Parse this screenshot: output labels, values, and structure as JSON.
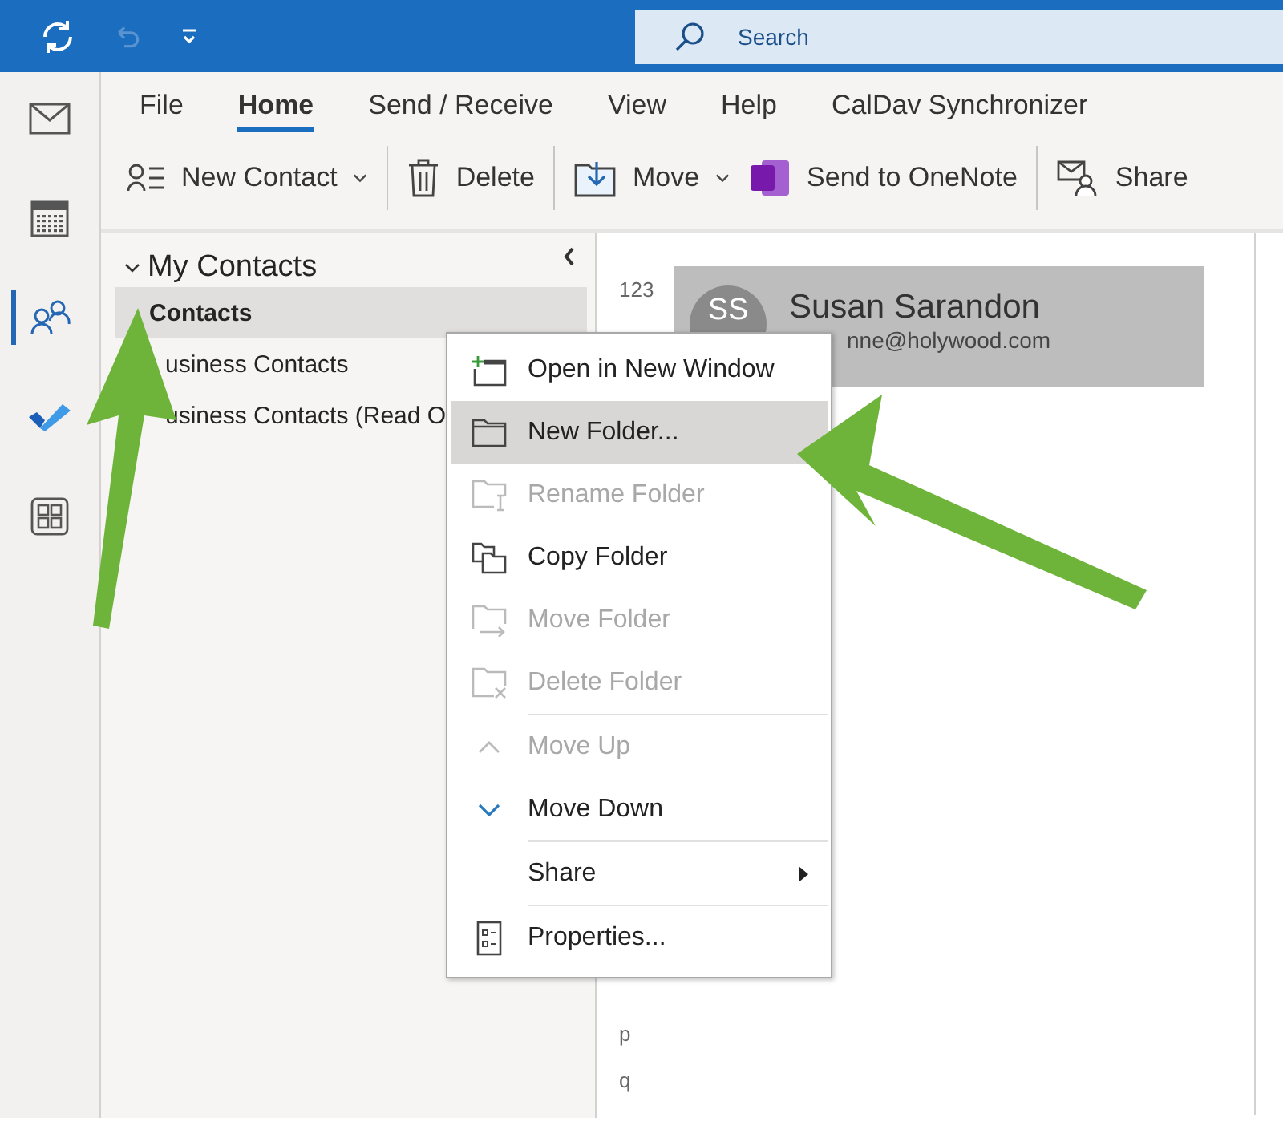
{
  "title_bar": {
    "search": {
      "placeholder": "Search"
    }
  },
  "nav_rail": [
    {
      "kind": "mail",
      "selected": false
    },
    {
      "kind": "calendar",
      "selected": false
    },
    {
      "kind": "people",
      "selected": true
    },
    {
      "kind": "todo",
      "selected": false
    },
    {
      "kind": "apps",
      "selected": false
    }
  ],
  "ribbon": {
    "tabs": [
      {
        "label": "File",
        "selected": false
      },
      {
        "label": "Home",
        "selected": true
      },
      {
        "label": "Send / Receive",
        "selected": false
      },
      {
        "label": "View",
        "selected": false
      },
      {
        "label": "Help",
        "selected": false
      },
      {
        "label": "CalDav Synchronizer",
        "selected": false
      }
    ],
    "commands": [
      {
        "label": "New Contact",
        "kind": "new-contact",
        "dropdown": true
      },
      {
        "label": "Delete",
        "kind": "delete",
        "dropdown": false
      },
      {
        "label": "Move",
        "kind": "move",
        "dropdown": true
      },
      {
        "label": "Send to OneNote",
        "kind": "onenote",
        "dropdown": false
      },
      {
        "label": "Share",
        "kind": "share",
        "dropdown": false
      }
    ]
  },
  "folder_pane": {
    "group": {
      "label": "My Contacts",
      "expanded": true,
      "children": [
        {
          "label": "Contacts",
          "selected": true
        },
        {
          "label": "usiness Contacts",
          "selected": false
        },
        {
          "label": "usiness Contacts (Read O",
          "selected": false
        }
      ]
    }
  },
  "contact_list": {
    "index": [
      {
        "label": "123"
      },
      {
        "label": "p"
      },
      {
        "label": "q"
      }
    ],
    "card": {
      "initials": "SS",
      "name": "Susan Sarandon",
      "email": "nne@holywood.com",
      "selected": true
    }
  },
  "context_menu": {
    "items": [
      {
        "label": "Open in New Window",
        "kind": "open-window",
        "disabled": false,
        "selected": false
      },
      {
        "label": "New Folder...",
        "kind": "folder",
        "disabled": false,
        "selected": true
      },
      {
        "label": "Rename Folder",
        "kind": "rename",
        "disabled": true,
        "selected": false
      },
      {
        "label": "Copy Folder",
        "kind": "copy",
        "disabled": false,
        "selected": false
      },
      {
        "label": "Move Folder",
        "kind": "move",
        "disabled": true,
        "selected": false
      },
      {
        "label": "Delete Folder",
        "kind": "delete",
        "disabled": true,
        "selected": false
      },
      {
        "label": "Move Up",
        "kind": "up",
        "disabled": true,
        "selected": false,
        "separator_before": true
      },
      {
        "label": "Move Down",
        "kind": "down",
        "disabled": false,
        "selected": false
      },
      {
        "label": "Share",
        "kind": "plain",
        "disabled": false,
        "selected": false,
        "submenu": true,
        "separator_before": true
      },
      {
        "label": "Properties...",
        "kind": "properties",
        "disabled": false,
        "selected": false,
        "separator_before": true
      }
    ]
  }
}
